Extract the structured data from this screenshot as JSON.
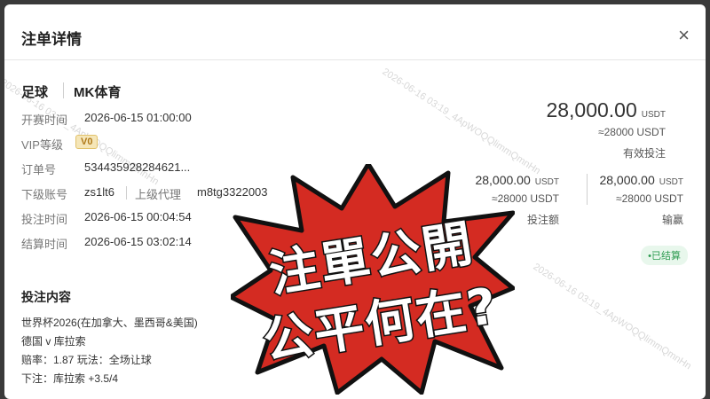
{
  "dialog": {
    "title": "注单详情",
    "close_label": "×"
  },
  "bet": {
    "sport": "足球",
    "venue": "MK体育",
    "fields": {
      "start_time_label": "开赛时间",
      "start_time": "2026-06-15 01:00:00",
      "vip_label": "VIP等级",
      "vip_value": "V0",
      "order_label": "订单号",
      "order_value": "534435928284621...",
      "sub_account_label": "下级账号",
      "sub_account_value": "zs1lt6",
      "agent_label": "上级代理",
      "agent_value": "m8tg3322003",
      "bet_time_label": "投注时间",
      "bet_time": "2026-06-15 00:04:54",
      "settle_time_label": "结算时间",
      "settle_time": "2026-06-15 03:02:14"
    },
    "amounts": {
      "valid_bet_amount": "28,000.00",
      "valid_bet_unit": "USDT",
      "valid_bet_approx": "≈28000 USDT",
      "valid_bet_label": "有效投注",
      "stake_amount": "28,000.00",
      "stake_unit": "USDT",
      "stake_approx": "≈28000 USDT",
      "stake_label": "投注额",
      "winloss_amount": "28,000.00",
      "winloss_unit": "USDT",
      "winloss_approx": "≈28000 USDT",
      "winloss_label": "输赢"
    },
    "status": "•已结算",
    "content": {
      "section_title": "投注内容",
      "line1": "世界杯2026(在加拿大、墨西哥&美国)",
      "line2": "德国 v 库拉索",
      "line3": "赔率：1.87 玩法：全场让球",
      "line4": "下注：库拉索 +3.5/4"
    }
  },
  "overlay": {
    "line1": "注單公開",
    "line2": "公平何在?",
    "burst_color": "#d42b22"
  },
  "watermark": "2026-06-16 03:19_4ApWOQQlimmQmnHn"
}
